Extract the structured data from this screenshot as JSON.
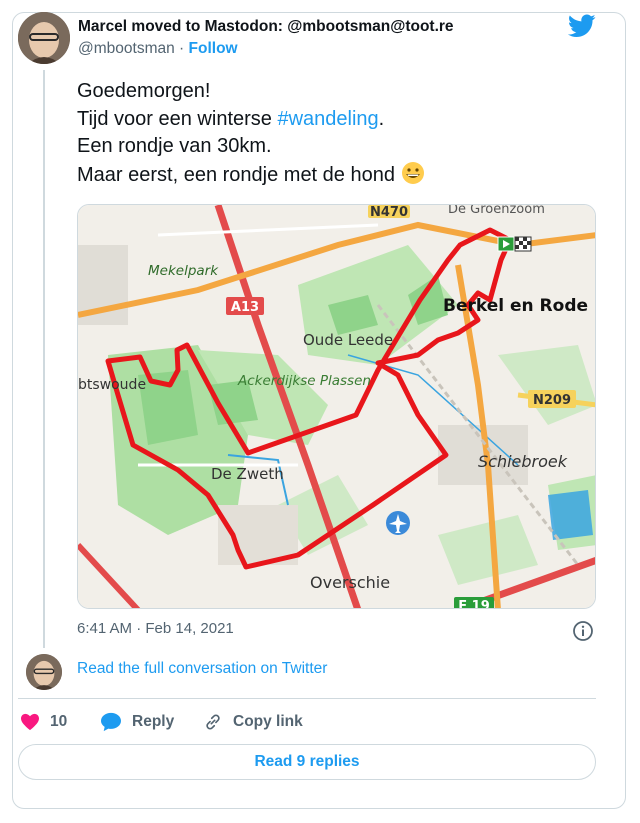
{
  "tweet": {
    "author_name": "Marcel moved to Mastodon: @mbootsman@toot.re",
    "handle": "@mbootsman",
    "separator": "·",
    "follow_label": "Follow",
    "text_line1": "Goedemorgen!",
    "text_line2_prefix": "Tijd voor een winterse ",
    "hashtag": "#wandeling",
    "text_line2_suffix": ".",
    "text_line3": "Een rondje van 30km.",
    "text_line4": "Maar eerst, een rondje met de hond ",
    "emoji": "grinning-face-icon",
    "timestamp": "6:41 AM · Feb 14, 2021"
  },
  "map": {
    "labels": {
      "n470": "N470",
      "de_groenzoom": "De Groenzoom",
      "mekelpark": "Mekelpark",
      "a13": "A13",
      "berkel": "Berkel en Rode",
      "oude_leede": "Oude Leede",
      "btswoude": "btswoude",
      "ackerdijkse": "Ackerdijkse Plassen",
      "n209": "N209",
      "schiebroek": "Schiebroek",
      "de_zweth": "De Zweth",
      "overschie": "Overschie",
      "e19": "E 19"
    },
    "colors": {
      "route": "#e8161b",
      "road_orange": "#f4a741",
      "road_red": "#e34b4b",
      "green": "#8fd38a",
      "water": "#3aa4e0",
      "background": "#f2efe9"
    }
  },
  "conversation": {
    "read_full_label": "Read the full conversation on Twitter"
  },
  "actions": {
    "like_count": "10",
    "reply_label": "Reply",
    "copy_link_label": "Copy link",
    "read_replies_label": "Read 9 replies"
  },
  "colors": {
    "accent": "#1d9bf0",
    "like": "#f91880",
    "muted": "#536471",
    "border": "#cfd9de"
  }
}
